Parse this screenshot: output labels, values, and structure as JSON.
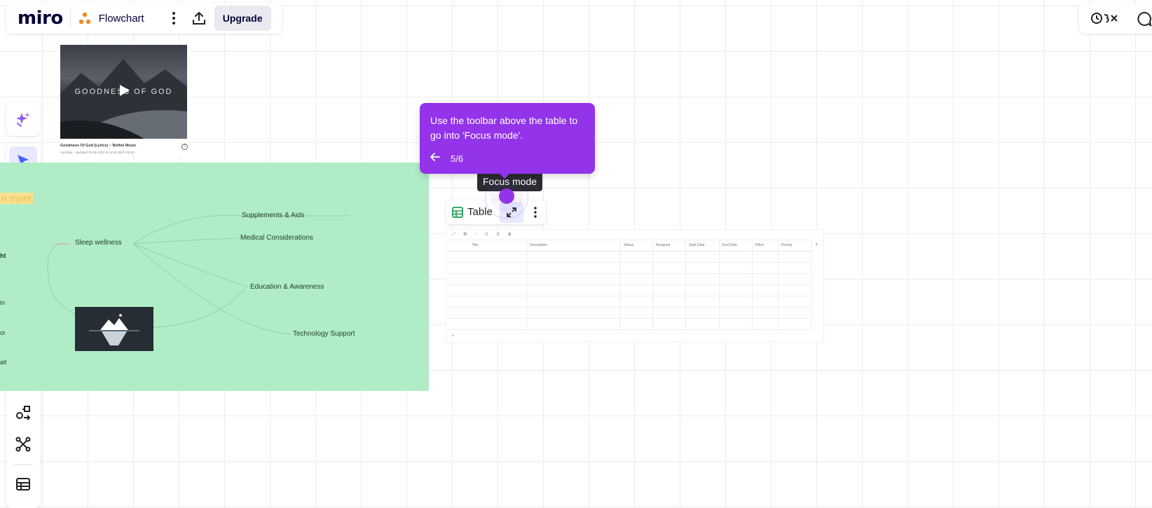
{
  "header": {
    "logo": "miro",
    "board_name": "Flowchart",
    "upgrade_label": "Upgrade"
  },
  "video": {
    "overlay_title": "GOODNESS OF GOD",
    "caption": "Goodness Of God (Lyrics) ~ Bethel Music",
    "subcaption": "YouTube · Updated 10-09-2022 at 14:28 GMT+00:00"
  },
  "mindmap": {
    "root_fragment": "n     ment",
    "nodes": {
      "sleep_wellness": "Sleep wellness",
      "supplements": "Supplements & Aids",
      "medical": "Medical Considerations",
      "education": "Education & Awareness",
      "technology": "Technology Support"
    },
    "edge_fragments": [
      "ht",
      "in",
      "oi",
      "alt"
    ]
  },
  "tooltip": {
    "text": "Use the toolbar above the table to go into 'Focus mode'.",
    "back_icon": "arrow-left-icon",
    "step": "5/6"
  },
  "focus_mode_label": "Focus mode",
  "table_toolbar": {
    "label": "Table"
  },
  "table": {
    "columns": [
      "Title",
      "Description",
      "Status",
      "Assignee",
      "Start Date",
      "End Date",
      "Effort",
      "Priority"
    ],
    "add_column": "+",
    "add_row": "+",
    "row_count": 7
  },
  "colors": {
    "accent": "#9333ea",
    "mindmap_bg": "#b0edc7",
    "selected_tool_bg": "#e6e9ff",
    "tool_icon_active": "#4262ff"
  },
  "icons": {
    "left_toolbar": [
      "select-icon",
      "templates-icon",
      "text-icon",
      "sticky-note-icon",
      "shapes-icon",
      "pen-icon",
      "comment-icon",
      "frame-icon",
      "diagram-icon",
      "mindmap-icon",
      "table-icon"
    ]
  }
}
